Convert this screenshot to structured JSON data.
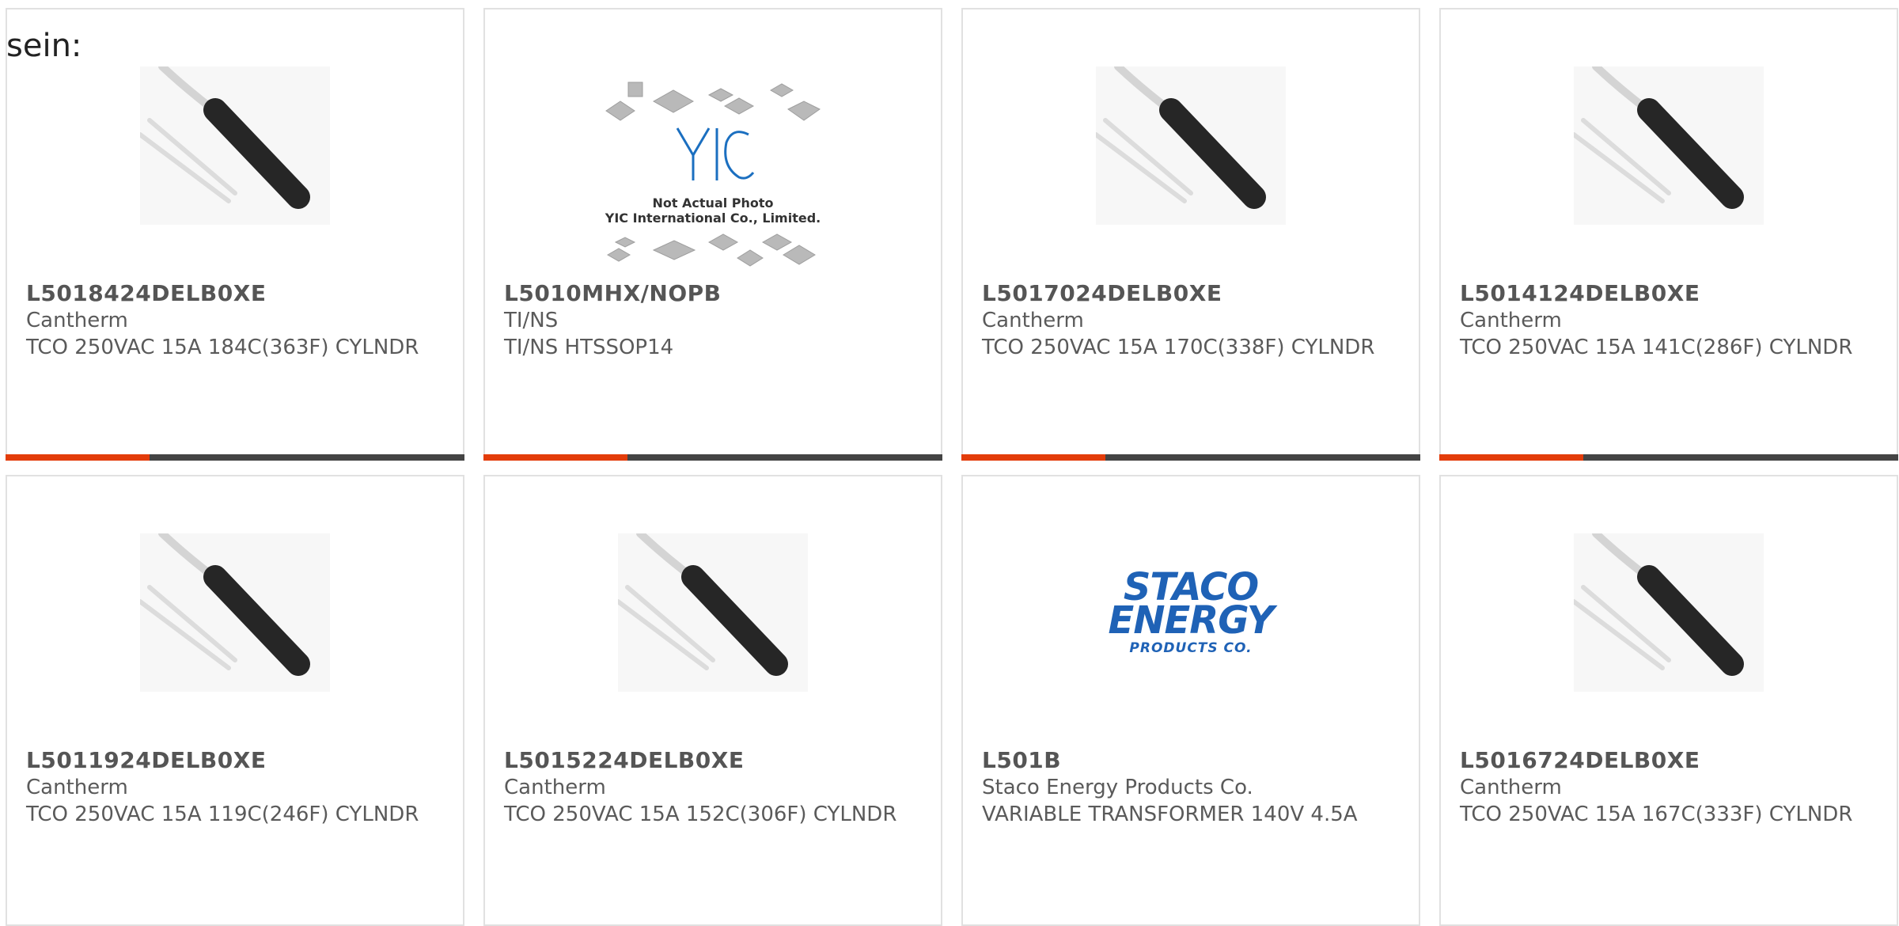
{
  "page": {
    "intro_text": "sein:"
  },
  "colors": {
    "accent": "#e33c0a",
    "bar": "#444444",
    "border": "#e1e1e1",
    "staco_blue": "#1f62b6"
  },
  "products": [
    {
      "part": "L5018424DELB0XE",
      "maker": "Cantherm",
      "desc": "TCO 250VAC 15A 184C(363F) CYLNDR",
      "image": "thermal-cutoff",
      "bar": true
    },
    {
      "part": "L5010MHX/NOPB",
      "maker": "TI/NS",
      "desc": "TI/NS HTSSOP14",
      "image": "yic-placeholder",
      "bar": true,
      "image_text": {
        "note1": "Not Actual Photo",
        "note2": "YIC International Co., Limited."
      }
    },
    {
      "part": "L5017024DELB0XE",
      "maker": "Cantherm",
      "desc": "TCO 250VAC 15A 170C(338F) CYLNDR",
      "image": "thermal-cutoff",
      "bar": true
    },
    {
      "part": "L5014124DELB0XE",
      "maker": "Cantherm",
      "desc": "TCO 250VAC 15A 141C(286F) CYLNDR",
      "image": "thermal-cutoff",
      "bar": true
    },
    {
      "part": "L5011924DELB0XE",
      "maker": "Cantherm",
      "desc": "TCO 250VAC 15A 119C(246F) CYLNDR",
      "image": "thermal-cutoff",
      "bar": false
    },
    {
      "part": "L5015224DELB0XE",
      "maker": "Cantherm",
      "desc": "TCO 250VAC 15A 152C(306F) CYLNDR",
      "image": "thermal-cutoff",
      "bar": false
    },
    {
      "part": "L501B",
      "maker": "Staco Energy Products Co.",
      "desc": "VARIABLE TRANSFORMER 140V 4.5A",
      "image": "staco-logo",
      "bar": false,
      "image_text": {
        "line1": "STACO",
        "line2": "ENERGY",
        "line3": "PRODUCTS CO."
      }
    },
    {
      "part": "L5016724DELB0XE",
      "maker": "Cantherm",
      "desc": "TCO 250VAC 15A 167C(333F) CYLNDR",
      "image": "thermal-cutoff",
      "bar": false
    }
  ]
}
